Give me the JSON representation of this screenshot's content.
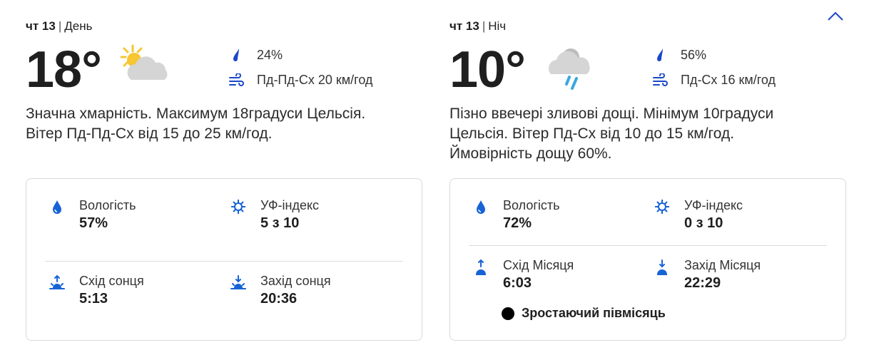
{
  "colors": {
    "accent": "#1a47c9",
    "icon_blue": "#1763d6",
    "sun": "#f6c633",
    "cloud": "#d5d5d5"
  },
  "day": {
    "dayname": "чт 13",
    "separator": "|",
    "part": "День",
    "temperature": "18°",
    "condition_icon": "partly-cloudy-icon",
    "precip": "24%",
    "wind": "Пд-Пд-Сх 20 км/год",
    "description": "Значна хмарність. Максимум 18градуси Цельсія. Вітер Пд-Пд-Сх від 15 до 25 км/год.",
    "details": {
      "humidity_label": "Вологість",
      "humidity_value": "57%",
      "uv_label": "УФ-індекс",
      "uv_value": "5 з 10",
      "rise_label": "Схід сонця",
      "rise_value": "5:13",
      "set_label": "Захід сонця",
      "set_value": "20:36"
    }
  },
  "night": {
    "dayname": "чт 13",
    "separator": "|",
    "part": "Ніч",
    "temperature": "10°",
    "condition_icon": "rain-showers-icon",
    "precip": "56%",
    "wind": "Пд-Сх 16 км/год",
    "description": "Пізно ввечері зливові дощі. Мінімум 10градуси Цельсія. Вітер Пд-Сх від 10 до 15 км/год. Ймовірність дощу 60%.",
    "details": {
      "humidity_label": "Вологість",
      "humidity_value": "72%",
      "uv_label": "УФ-індекс",
      "uv_value": "0 з 10",
      "rise_label": "Схід Місяця",
      "rise_value": "6:03",
      "set_label": "Захід Місяця",
      "set_value": "22:29",
      "moon_phase": "Зростаючий півмісяць"
    }
  }
}
